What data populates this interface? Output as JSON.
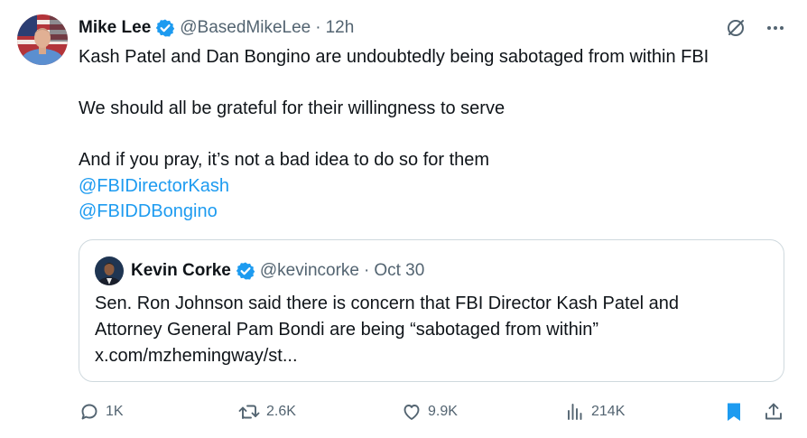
{
  "tweet": {
    "author_name": "Mike Lee",
    "handle": "@BasedMikeLee",
    "separator": "·",
    "time": "12h",
    "lines": [
      "Kash Patel and Dan Bongino are undoubtedly being sabotaged from within FBI",
      "We should all be grateful for their willingness to serve",
      "And if you pray, it’s not a bad idea to do so for them"
    ],
    "mentions": [
      "@FBIDirectorKash",
      "@FBIDDBongino"
    ]
  },
  "quote": {
    "author_name": "Kevin Corke",
    "handle": "@kevincorke",
    "separator": "·",
    "date": "Oct 30",
    "lines": [
      "Sen. Ron Johnson said there is concern that FBI Director Kash Patel and",
      "Attorney General Pam Bondi are being “sabotaged from within”",
      "x.com/mzhemingway/st..."
    ]
  },
  "actions": {
    "replies": "1K",
    "reposts": "2.6K",
    "likes": "9.9K",
    "views": "214K"
  },
  "icons": {
    "grok": "grok-icon",
    "more": "more-icon",
    "reply": "reply-icon",
    "repost": "repost-icon",
    "like": "like-icon",
    "views": "views-icon",
    "bookmark": "bookmark-icon",
    "share": "share-icon"
  },
  "colors": {
    "text": "#0f1419",
    "muted": "#536471",
    "link": "#1d9bf0",
    "verified": "#1d9bf0",
    "bookmark_active": "#1d9bf0",
    "border": "#cfd9de"
  }
}
